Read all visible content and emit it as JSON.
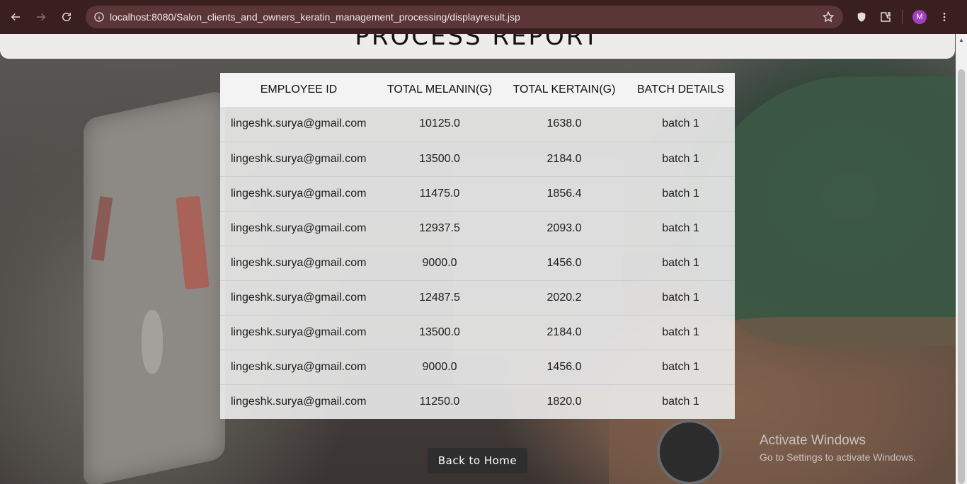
{
  "browser": {
    "url": "localhost:8080/Salon_clients_and_owners_keratin_management_processing/displayresult.jsp",
    "profile_initial": "M"
  },
  "page": {
    "title": "PROCESS REPORT",
    "back_button": "Back to Home"
  },
  "table": {
    "headers": [
      "EMPLOYEE ID",
      "TOTAL MELANIN(G)",
      "TOTAL KERTAIN(G)",
      "BATCH DETAILS"
    ],
    "rows": [
      [
        "lingeshk.surya@gmail.com",
        "10125.0",
        "1638.0",
        "batch 1"
      ],
      [
        "lingeshk.surya@gmail.com",
        "13500.0",
        "2184.0",
        "batch 1"
      ],
      [
        "lingeshk.surya@gmail.com",
        "11475.0",
        "1856.4",
        "batch 1"
      ],
      [
        "lingeshk.surya@gmail.com",
        "12937.5",
        "2093.0",
        "batch 1"
      ],
      [
        "lingeshk.surya@gmail.com",
        "9000.0",
        "1456.0",
        "batch 1"
      ],
      [
        "lingeshk.surya@gmail.com",
        "12487.5",
        "2020.2",
        "batch 1"
      ],
      [
        "lingeshk.surya@gmail.com",
        "13500.0",
        "2184.0",
        "batch 1"
      ],
      [
        "lingeshk.surya@gmail.com",
        "9000.0",
        "1456.0",
        "batch 1"
      ],
      [
        "lingeshk.surya@gmail.com",
        "11250.0",
        "1820.0",
        "batch 1"
      ]
    ]
  },
  "watermark": {
    "line1": "Activate Windows",
    "line2": "Go to Settings to activate Windows."
  },
  "colors": {
    "chrome_bg": "#3a1f1f",
    "omnibox_bg": "#5a3636",
    "button_bg": "#2e2e2e",
    "avatar_bg": "#a23fbf"
  }
}
